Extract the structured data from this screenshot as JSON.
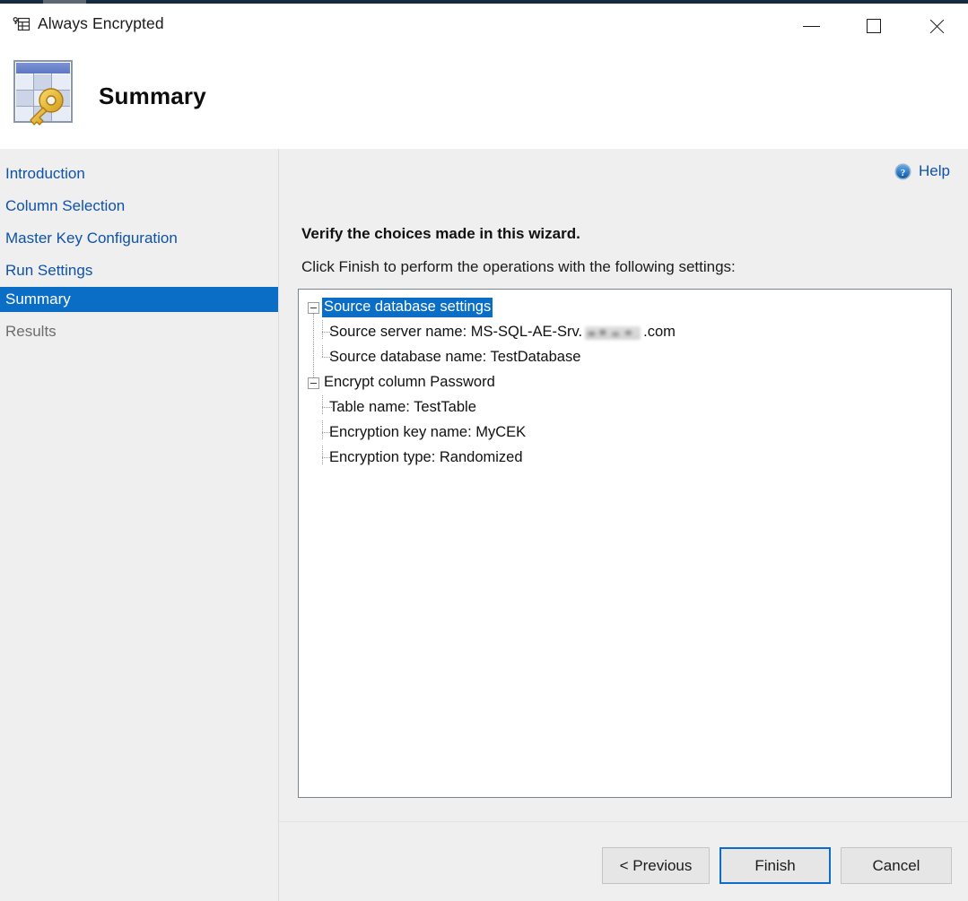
{
  "window": {
    "title": "Always Encrypted",
    "icon": "always-encrypted-icon",
    "controls": {
      "minimize": "Minimize",
      "maximize": "Maximize",
      "close": "Close"
    }
  },
  "banner": {
    "icon": "table-key-icon",
    "title": "Summary"
  },
  "sidebar": {
    "items": [
      {
        "label": "Introduction",
        "state": "link"
      },
      {
        "label": "Column Selection",
        "state": "link"
      },
      {
        "label": "Master Key Configuration",
        "state": "link"
      },
      {
        "label": "Run Settings",
        "state": "link"
      },
      {
        "label": "Summary",
        "state": "active"
      },
      {
        "label": "Results",
        "state": "disabled"
      }
    ]
  },
  "help": {
    "icon": "help-circle-icon",
    "label": "Help"
  },
  "main": {
    "heading": "Verify the choices made in this wizard.",
    "subheading": "Click Finish to perform the operations with the following settings:",
    "tree": [
      {
        "label": "Source database settings",
        "selected": true,
        "expanded": true,
        "children": [
          {
            "label": "Source server name: MS-SQL-AE-Srv.",
            "redacted": true,
            "suffix": ".com"
          },
          {
            "label": "Source database name: TestDatabase"
          }
        ]
      },
      {
        "label": "Encrypt column Password",
        "selected": false,
        "expanded": true,
        "children": [
          {
            "label": "Table name: TestTable"
          },
          {
            "label": "Encryption key name: MyCEK"
          },
          {
            "label": "Encryption type: Randomized"
          }
        ]
      }
    ]
  },
  "footer": {
    "previous": "< Previous",
    "finish": "Finish",
    "cancel": "Cancel"
  },
  "colors": {
    "accent": "#0b6ec6",
    "link": "#0f52a8",
    "panel": "#efefef",
    "titlebar_strip": "#162b40"
  }
}
